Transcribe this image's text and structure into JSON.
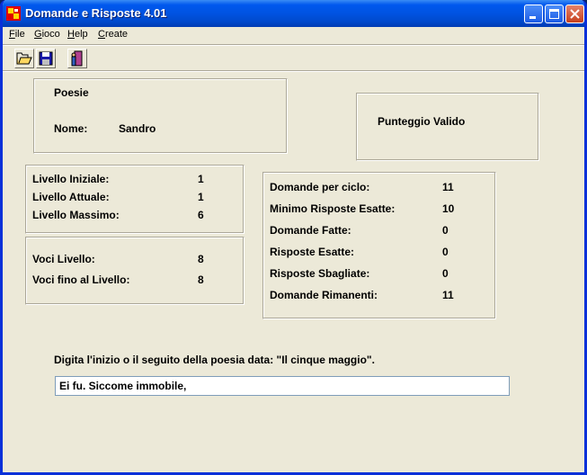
{
  "window": {
    "title": "Domande e Risposte 4.01"
  },
  "menu": [
    {
      "accel": "F",
      "rest": "ile"
    },
    {
      "accel": "G",
      "rest": "ioco"
    },
    {
      "accel": "H",
      "rest": "elp"
    },
    {
      "accel": "C",
      "rest": "reate"
    }
  ],
  "toolbar": {
    "icons": [
      "open-folder-icon",
      "save-disk-icon",
      "exit-door-icon"
    ]
  },
  "player": {
    "category": "Poesie",
    "name_label": "Nome:",
    "name_value": "Sandro"
  },
  "score_box": {
    "label": "Punteggio Valido"
  },
  "levels": {
    "initial_label": "Livello Iniziale:",
    "initial_value": "1",
    "current_label": "Livello Attuale:",
    "current_value": "1",
    "max_label": "Livello Massimo:",
    "max_value": "6"
  },
  "entries": {
    "level_label": "Voci Livello:",
    "level_value": "8",
    "upto_label": "Voci fino al Livello:",
    "upto_value": "8"
  },
  "stats": {
    "per_cycle_label": "Domande per ciclo:",
    "per_cycle_value": "11",
    "min_correct_label": "Minimo Risposte Esatte:",
    "min_correct_value": "10",
    "asked_label": "Domande Fatte:",
    "asked_value": "0",
    "correct_label": "Risposte Esatte:",
    "correct_value": "0",
    "wrong_label": "Risposte Sbagliate:",
    "wrong_value": "0",
    "remaining_label": "Domande Rimanenti:",
    "remaining_value": "11"
  },
  "prompt": {
    "text": "Digita l'inizio o il seguito della poesia data: \"Il cinque maggio\".",
    "answer": "Ei fu. Siccome immobile,"
  }
}
